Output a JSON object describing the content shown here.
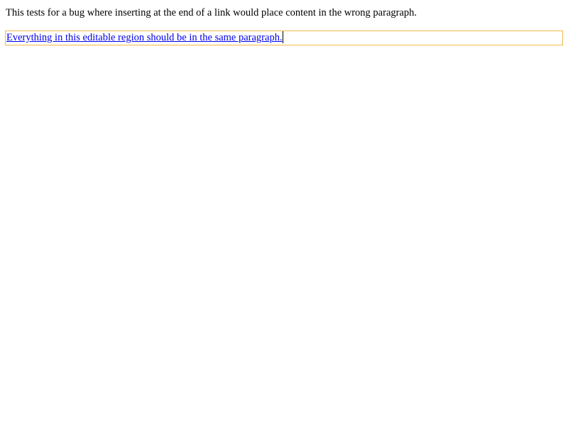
{
  "description": {
    "text": "This tests for a bug where inserting at the end of a link would place content in the wrong paragraph."
  },
  "editable_region": {
    "link_text": "Everything in this editable region should be in the same paragraph.",
    "border_color": "#f0b849",
    "link_color": "#0000ee"
  }
}
